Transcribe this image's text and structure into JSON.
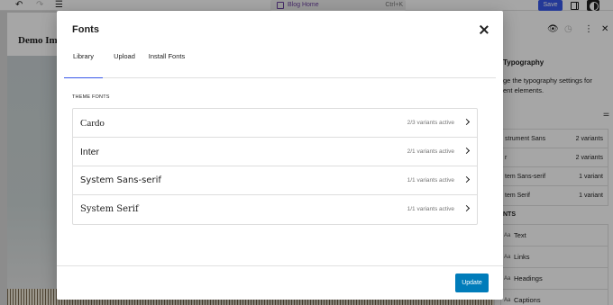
{
  "editor": {
    "command_bar": {
      "title": "Blog Home",
      "shortcut": "Ctrl+K"
    },
    "save_label": "Save",
    "site_title": "Demo Im",
    "sidebar": {
      "heading": "Typography",
      "description": "ge the typography settings for\nent elements.",
      "font_items": [
        {
          "name": "strument Sans",
          "count": "2 variants"
        },
        {
          "name": "r",
          "count": "2 variants"
        },
        {
          "name": "tem Sans-serif",
          "count": "1 variant"
        },
        {
          "name": "tem Serif",
          "count": "1 variant"
        }
      ],
      "elements_header": "NTS",
      "element_items": [
        "Text",
        "Links",
        "Headings",
        "Captions"
      ],
      "element_icon": "Aa"
    }
  },
  "modal": {
    "title": "Fonts",
    "tabs": [
      "Library",
      "Upload",
      "Install Fonts"
    ],
    "active_tab": "Library",
    "section_label": "THEME FONTS",
    "fonts": [
      {
        "name": "Cardo",
        "variants": "2/3 variants active"
      },
      {
        "name": "Inter",
        "variants": "2/1 variants active"
      },
      {
        "name": "System Sans-serif",
        "variants": "1/1 variants active"
      },
      {
        "name": "System Serif",
        "variants": "1/1 variants active"
      }
    ],
    "update_label": "Update"
  },
  "colors": {
    "accent": "#3858e9",
    "update_button": "#007cba",
    "command_title": "#6b3fa0"
  },
  "icons": [
    "undo-icon",
    "redo-icon",
    "list-view-icon",
    "close-icon",
    "chevron-right-icon",
    "eye-icon",
    "revisions-icon",
    "adjust-icon"
  ]
}
